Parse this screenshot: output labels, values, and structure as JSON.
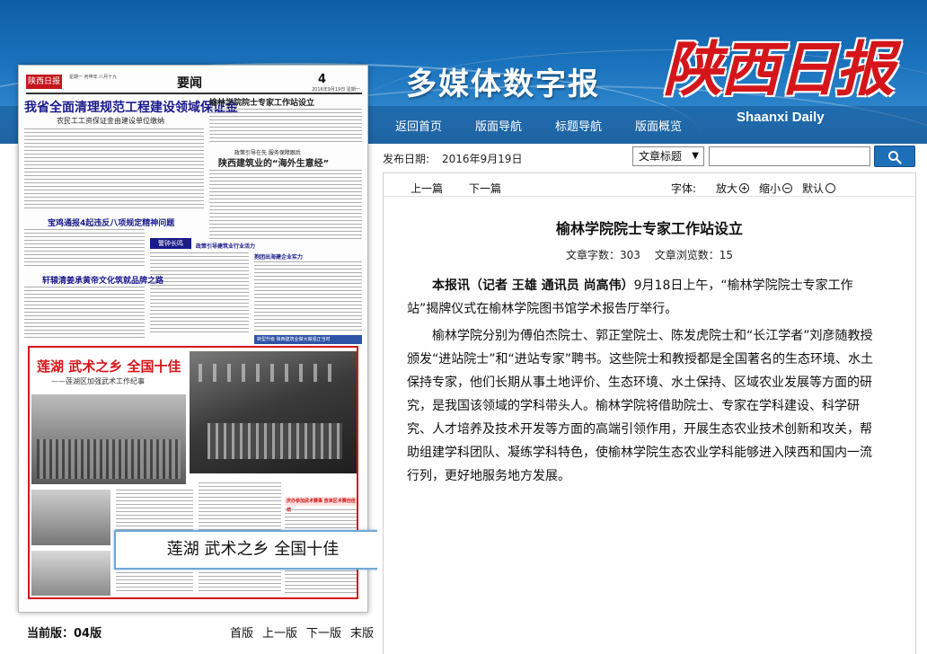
{
  "header": {
    "site_title": "多媒体数字报",
    "logo_cn": "陕西日报",
    "logo_en": "Shaanxi Daily",
    "nav": [
      "返回首页",
      "版面导航",
      "标题导航",
      "版面概览"
    ]
  },
  "paper": {
    "logo": "陕西日报",
    "masthead_small": "星期一 丙申年 八月十九",
    "section": "要闻",
    "page_num": "4",
    "date_line": "2016年9月19日 星期一",
    "headline1": "我省全面清理规范工程建设领域保证金",
    "sub1": "农民工工资保证金由建设单位缴纳",
    "headline2": "榆林学院院士专家工作站设立",
    "kicker3": "政策引导在先 服务保障跟后",
    "headline3": "陕西建筑业的“海外生意经”",
    "headline4": "宝鸡通报4起违反八项规定精神问题",
    "headline5": "轩辕清姜承黄帝文化筑就品牌之路",
    "bar_a": "警钟长鸣",
    "tag_a": "政策引导建筑业行业活力",
    "tag_b": "抱团出海建企业实力",
    "strip": "转型升级 陕西建筑业做大做强正当时",
    "feature": {
      "title": "莲湖 武术之乡 全国十佳",
      "subtitle": "——莲湖区加强武术工作纪事",
      "red_bar": "庆办参加武术赛事 放来区术赛创佳绩"
    },
    "overlay": "莲湖 武术之乡 全国十佳",
    "current_label": "当前版：04版",
    "pager": [
      "首版",
      "上一版",
      "下一版",
      "末版"
    ]
  },
  "search": {
    "date_label": "发布日期:",
    "date_value": "2016年9月19日",
    "select_value": "文章标题",
    "input_value": ""
  },
  "article": {
    "toolbar": {
      "prev": "上一篇",
      "next": "下一篇",
      "font_label": "字体:",
      "larger": "放大",
      "smaller": "缩小",
      "default": "默认"
    },
    "title": "榆林学院院士专家工作站设立",
    "word_count": "文章字数：303",
    "views": "文章浏览数：15",
    "para1_lead": "本报讯（记者 王雄 通讯员 尚高伟）",
    "para1_rest": "9月18日上午，“榆林学院院士专家工作站”揭牌仪式在榆林学院图书馆学术报告厅举行。",
    "para2": "榆林学院分别为傅伯杰院士、郭正堂院士、陈发虎院士和“长江学者”刘彦随教授颁发“进站院士”和“进站专家”聘书。这些院士和教授都是全国著名的生态环境、水土保持专家，他们长期从事土地评价、生态环境、水土保持、区域农业发展等方面的研究，是我国该领域的学科带头人。榆林学院将借助院士、专家在学科建设、科学研究、人才培养及技术开发等方面的高端引领作用，开展生态农业技术创新和攻关，帮助组建学科团队、凝练学科特色，使榆林学院生态农业学科能够进入陕西和国内一流行列，更好地服务地方发展。"
  },
  "colors": {
    "header_blue": "#1b73bd",
    "logo_red": "#d4161b",
    "feature_red": "#d4161b",
    "paper_headline_blue": "#1a1a8a"
  }
}
